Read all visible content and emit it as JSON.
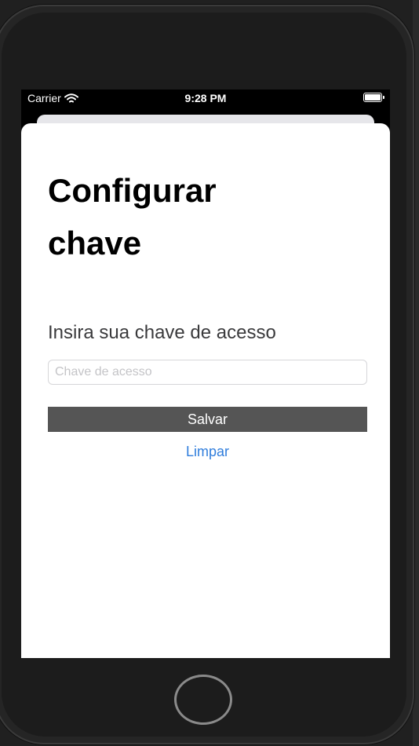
{
  "status_bar": {
    "carrier": "Carrier",
    "time": "9:28 PM",
    "wifi_icon": "wifi-icon",
    "battery_icon": "battery-icon"
  },
  "sheet": {
    "title": "Configurar chave",
    "prompt": "Insira sua chave de acesso",
    "input": {
      "value": "",
      "placeholder": "Chave de acesso"
    },
    "save_label": "Salvar",
    "clear_label": "Limpar"
  },
  "colors": {
    "save_button_bg": "#555555",
    "link": "#2f7ddc",
    "sheet_bg": "#ffffff"
  }
}
